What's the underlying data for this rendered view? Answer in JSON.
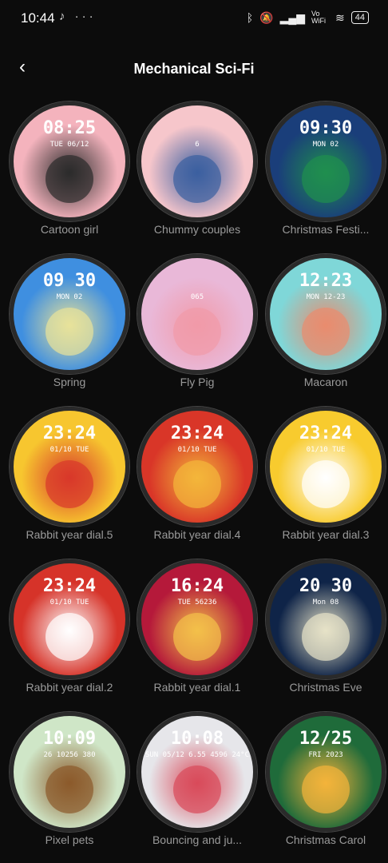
{
  "status": {
    "time": "10:44",
    "extra": "♪ ···",
    "signal": "Vo WiFi",
    "battery": "44"
  },
  "header": {
    "title": "Mechanical Sci-Fi",
    "back_icon": "‹"
  },
  "faces": [
    {
      "label": "Cartoon girl",
      "time": "08:25",
      "date": "TUE 06/12",
      "bg": "#f4b3bd",
      "accent": "#2b2b2b"
    },
    {
      "label": "Chummy couples",
      "time": "",
      "date": "6",
      "bg": "#f6c6cb",
      "accent": "#3b5fa0"
    },
    {
      "label": "Christmas Festi...",
      "time": "09:30",
      "date": "MON 02",
      "bg": "#1a3e7a",
      "accent": "#1f8f4e"
    },
    {
      "label": "Spring",
      "time": "09 30",
      "date": "MON 02",
      "bg": "#3f8fe0",
      "accent": "#e8e29a"
    },
    {
      "label": "Fly Pig",
      "time": "",
      "date": "065",
      "bg": "#e9b8d8",
      "accent": "#f19aa8"
    },
    {
      "label": "Macaron",
      "time": "12:23",
      "date": "MON 12-23",
      "bg": "#7fd7d8",
      "accent": "#e98b6e"
    },
    {
      "label": "Rabbit year dial.5",
      "time": "23:24",
      "date": "01/10 TUE",
      "bg": "#f7c62f",
      "accent": "#d8382b"
    },
    {
      "label": "Rabbit year dial.4",
      "time": "23:24",
      "date": "01/10 TUE",
      "bg": "#d93628",
      "accent": "#f3b63a"
    },
    {
      "label": "Rabbit year dial.3",
      "time": "23:24",
      "date": "01/10 TUE",
      "bg": "#f8cb2e",
      "accent": "#ffffff"
    },
    {
      "label": "Rabbit year dial.2",
      "time": "23:24",
      "date": "01/10 TUE",
      "bg": "#d63329",
      "accent": "#ffffff"
    },
    {
      "label": "Rabbit year dial.1",
      "time": "16:24",
      "date": "TUE 56236",
      "bg": "#b5193a",
      "accent": "#f3c14a"
    },
    {
      "label": "Christmas Eve",
      "time": "20 30",
      "date": "Mon 08",
      "bg": "#0f2448",
      "accent": "#e7e3c8"
    },
    {
      "label": "Pixel pets",
      "time": "10:09",
      "date": "26 10256 380",
      "bg": "#cfe6c7",
      "accent": "#8b5a2b"
    },
    {
      "label": "Bouncing and ju...",
      "time": "10:08",
      "date": "SUN 05/12 6.55 4596 24°C",
      "bg": "#e6e6ea",
      "accent": "#d94a5a"
    },
    {
      "label": "Christmas Carol",
      "time": "12/25",
      "date": "FRI 2023",
      "bg": "#1f6b3a",
      "accent": "#f3b33a"
    }
  ]
}
